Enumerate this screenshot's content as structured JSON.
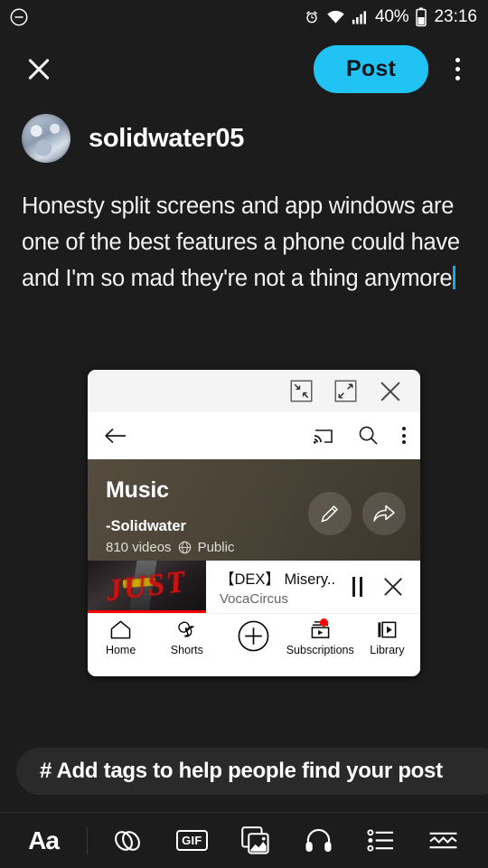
{
  "status_bar": {
    "left_icon": "minus-circle-icon",
    "icons": [
      "alarm-clock-icon",
      "wifi-icon",
      "cell-signal-icon",
      "battery-icon"
    ],
    "battery_percent": "40%",
    "time": "23:16"
  },
  "toolbar": {
    "close_icon": "close-icon",
    "post_label": "Post",
    "overflow_icon": "kebab-menu-icon",
    "post_button_color": "#21c3f5"
  },
  "author": {
    "username": "solidwater05",
    "avatar_icon": "avatar"
  },
  "composer": {
    "text": "Honesty split screens and app windows are one of the best features a phone could have and I'm so mad they're not a thing anymore",
    "caret_color": "#21a7e0"
  },
  "app_window": {
    "chrome": {
      "minimize_icon": "arrows-in-icon",
      "maximize_icon": "arrows-out-icon",
      "close_icon": "close-icon"
    },
    "app_bar": {
      "back_icon": "back-arrow-icon",
      "cast_icon": "cast-icon",
      "search_icon": "search-icon",
      "overflow_icon": "kebab-menu-icon"
    },
    "playlist": {
      "title": "Music",
      "owner": "-Solidwater",
      "video_count": "810 videos",
      "privacy_icon": "globe-icon",
      "privacy": "Public",
      "edit_icon": "pencil-icon",
      "share_icon": "share-arrow-icon"
    },
    "mini_player": {
      "thumbnail_text": "JUST",
      "title": "【DEX】 Misery..",
      "channel": "VocaCircus",
      "pause_icon": "pause-icon",
      "close_icon": "close-icon",
      "progress_color": "#ff0000"
    },
    "bottom_nav": [
      {
        "label": "Home",
        "icon": "home-icon",
        "badge": false
      },
      {
        "label": "Shorts",
        "icon": "shorts-icon",
        "badge": false
      },
      {
        "label": "",
        "icon": "plus-circle-icon",
        "badge": false
      },
      {
        "label": "Subscriptions",
        "icon": "subscriptions-icon",
        "badge": true
      },
      {
        "label": "Library",
        "icon": "library-icon",
        "badge": false
      }
    ]
  },
  "tag_bar": {
    "placeholder": "# Add tags to help people find your post"
  },
  "bottom_toolbar": {
    "text_format_label": "Aa",
    "gif_label": "GIF",
    "icons": [
      "link-icon",
      "gif-icon",
      "image-icon",
      "headphones-icon",
      "poll-list-icon",
      "squiggle-icon"
    ]
  }
}
